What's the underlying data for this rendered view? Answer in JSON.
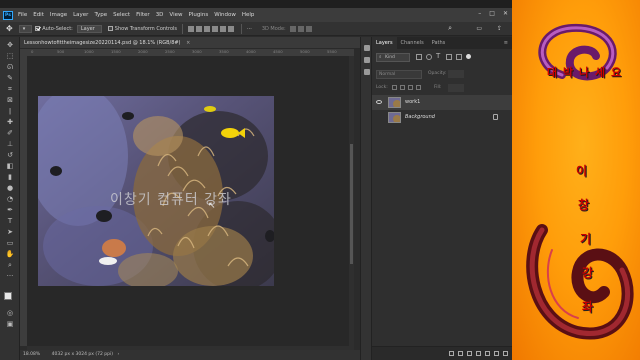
{
  "app": {
    "logo": "Ps"
  },
  "menu": [
    "File",
    "Edit",
    "Image",
    "Layer",
    "Type",
    "Select",
    "Filter",
    "3D",
    "View",
    "Plugins",
    "Window",
    "Help"
  ],
  "options_bar": {
    "auto_select_label": "Auto-Select:",
    "auto_select_target": "Layer",
    "transform_label": "Show Transform Controls",
    "mode_3d": "3D Mode:"
  },
  "document": {
    "tab_title": "Lessonhowtofittheimagesize20220114.psd @ 18.1% (RGB/8#)",
    "ruler_ticks": [
      "0",
      "500",
      "1000",
      "1500",
      "2000",
      "2500",
      "3000",
      "3500",
      "4000",
      "4500",
      "5000",
      "5500"
    ],
    "watermark": "이창기 컴퓨터 강좌",
    "zoom": "18.08%",
    "dimensions": "4032 px x 3024 px (72 ppi)"
  },
  "layers_panel": {
    "tabs": [
      "Layers",
      "Channels",
      "Paths"
    ],
    "active_tab": "Layers",
    "kind_label": "Kind",
    "blend_mode": "Normal",
    "opacity_label": "Opacity:",
    "lock_label": "Lock:",
    "fill_label": "Fill:",
    "layers": [
      {
        "name": "work1",
        "visible": true,
        "locked": false
      },
      {
        "name": "Background",
        "visible": false,
        "locked": true
      }
    ]
  },
  "side_banner": {
    "horizontal_chars": [
      "대",
      "박",
      "나",
      "세",
      "요"
    ],
    "vertical_chars": [
      "이",
      "창",
      "기",
      "강",
      "좌"
    ],
    "accent_color": "#c80000"
  }
}
